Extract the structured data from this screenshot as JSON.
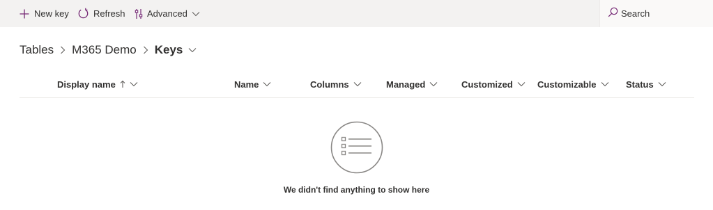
{
  "commandbar": {
    "new_key": "New key",
    "refresh": "Refresh",
    "advanced": "Advanced",
    "search_placeholder": "Search"
  },
  "breadcrumb": {
    "items": [
      "Tables",
      "M365 Demo"
    ],
    "current": "Keys"
  },
  "grid": {
    "columns": [
      "Display name",
      "Name",
      "Columns",
      "Managed",
      "Customized",
      "Customizable",
      "Status"
    ],
    "sort_column": "Display name",
    "sort_direction": "ascending"
  },
  "empty_state": {
    "message": "We didn't find anything to show here"
  },
  "colors": {
    "accent": "#742774",
    "commandbar_bg": "#f3f2f1",
    "text": "#323130"
  },
  "icons": {
    "new_key": "plus-icon",
    "refresh": "refresh-icon",
    "advanced": "advanced-filter-icon",
    "search": "search-icon",
    "empty": "bulleted-list-icon"
  }
}
